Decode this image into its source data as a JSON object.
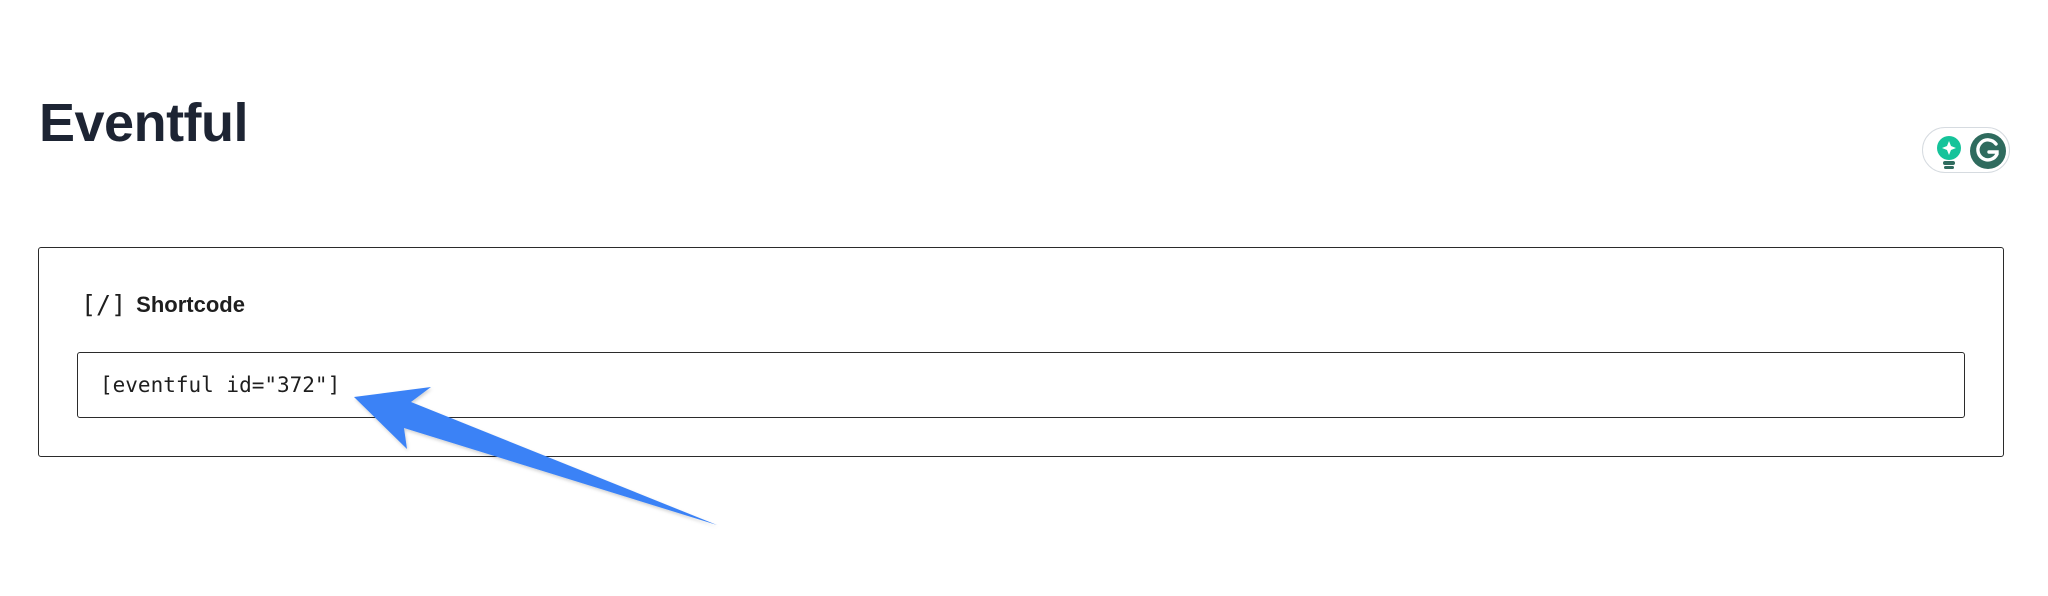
{
  "page": {
    "title": "Eventful"
  },
  "shortcode_panel": {
    "icon": "shortcode-brackets-icon",
    "icon_glyph": "[/]",
    "label": "Shortcode",
    "value": "[eventful id=\"372\"]"
  },
  "grammarly_widget": {
    "icons": [
      "lightbulb-icon",
      "grammarly-icon"
    ]
  },
  "colors": {
    "title": "#1d2433",
    "annotation_arrow": "#3b82f6",
    "grammarly_green": "#15c39a",
    "grammarly_dark": "#2f6b5e"
  }
}
